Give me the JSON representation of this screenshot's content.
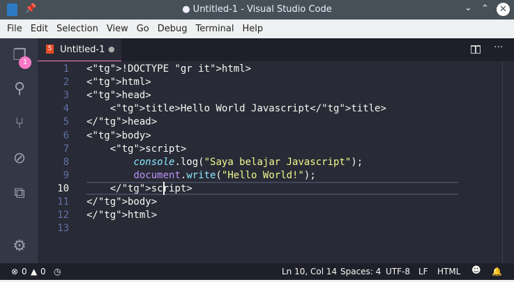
{
  "window": {
    "title": "● Untitled-1 - Visual Studio Code"
  },
  "menu": [
    "File",
    "Edit",
    "Selection",
    "View",
    "Go",
    "Debug",
    "Terminal",
    "Help"
  ],
  "activity": {
    "explorer_badge": "1"
  },
  "tab": {
    "label": "Untitled-1",
    "modified": "●"
  },
  "editor": {
    "line_numbers": [
      "1",
      "2",
      "3",
      "4",
      "5",
      "6",
      "7",
      "8",
      "9",
      "10",
      "11",
      "12",
      "13"
    ],
    "current_line": 10,
    "lines": [
      "<!DOCTYPE html>",
      "<html>",
      "<head>",
      "    <title>Hello World Javascript</title>",
      "</head>",
      "<body>",
      "    <script>",
      "        console.log(\"Saya belajar Javascript\");",
      "        document.write(\"Hello World!\");",
      "    </script>",
      "</body>",
      "</html>",
      ""
    ]
  },
  "status": {
    "errors": "0",
    "warnings": "0",
    "position": "Ln 10, Col 14",
    "spaces": "Spaces: 4",
    "encoding": "UTF-8",
    "eol": "LF",
    "language": "HTML"
  }
}
